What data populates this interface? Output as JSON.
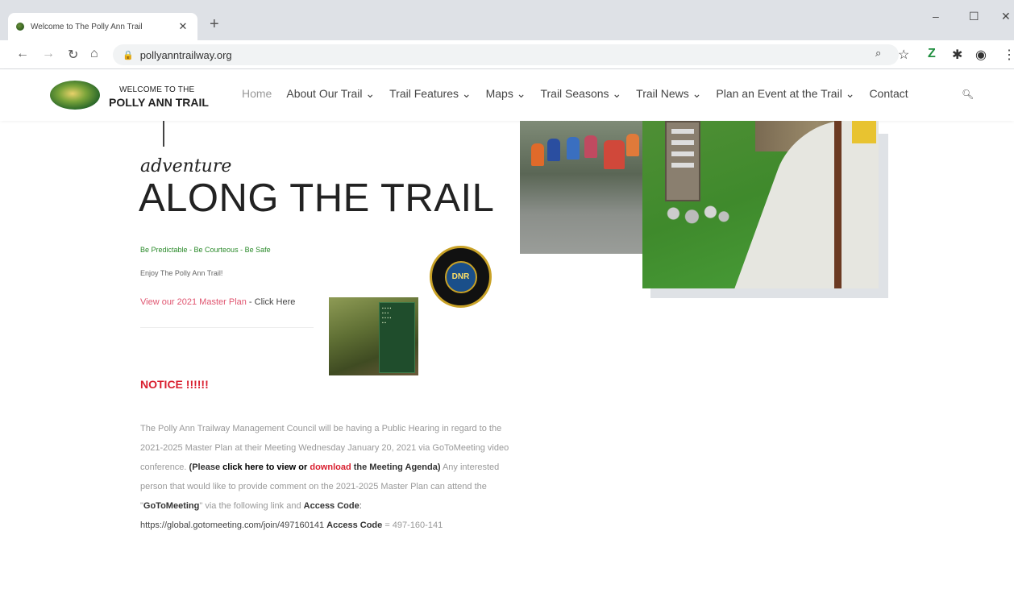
{
  "browser": {
    "tab_title": "Welcome to The Polly Ann Trail",
    "tab_close": "✕",
    "new_tab": "+",
    "url": "pollyanntrailway.org",
    "window_controls": {
      "minimize": "–",
      "maximize": "☐",
      "close": "✕"
    }
  },
  "site": {
    "logo": {
      "line1": "WELCOME TO THE",
      "line2": "POLLY ANN TRAIL"
    },
    "menu": [
      {
        "label": "Home"
      },
      {
        "label": "About Our Trail ⌄"
      },
      {
        "label": "Trail Features ⌄"
      },
      {
        "label": "Maps ⌄"
      },
      {
        "label": "Trail Seasons ⌄"
      },
      {
        "label": "Trail News ⌄"
      },
      {
        "label": "Plan an Event at the Trail ⌄"
      },
      {
        "label": "Contact"
      }
    ]
  },
  "hero": {
    "subtitle": "adventure",
    "headline": "ALONG THE TRAIL",
    "motto": "Be Predictable - Be Courteous - Be Safe",
    "enjoy": "Enjoy The Polly Ann Trail!",
    "master_plan_link": "View our 2021 Master Plan",
    "master_plan_click": " - Click Here",
    "dnr_label": "DNR"
  },
  "notice": {
    "title": "NOTICE !!!!!!",
    "p1": "The Polly Ann Trailway Management Council will be having a Public Hearing in regard to the 2021-2025 Master Plan at their Meeting Wednesday January 20, 2021 via GoToMeeting video conference.",
    "please_open": "(Please ",
    "click_here": "click here to view or ",
    "download": "download",
    "agenda": " the Meeting Agenda)",
    "p2": " Any interested person that would like to provide comment on the 2021-2025 Master Plan can attend the \"",
    "gotomeeting": "GoToMeeting",
    "p3": "\" via the following link and ",
    "access_code_label": "Access Code",
    "link": ":  https://global.gotomeeting.com/join/497160141 ",
    "access_code_label2": "Access Code",
    "code_value": " = 497-160-141"
  },
  "colors": {
    "notice_red": "#d92030",
    "motto_green": "#2a8a2a",
    "link_pink": "#e05570"
  }
}
